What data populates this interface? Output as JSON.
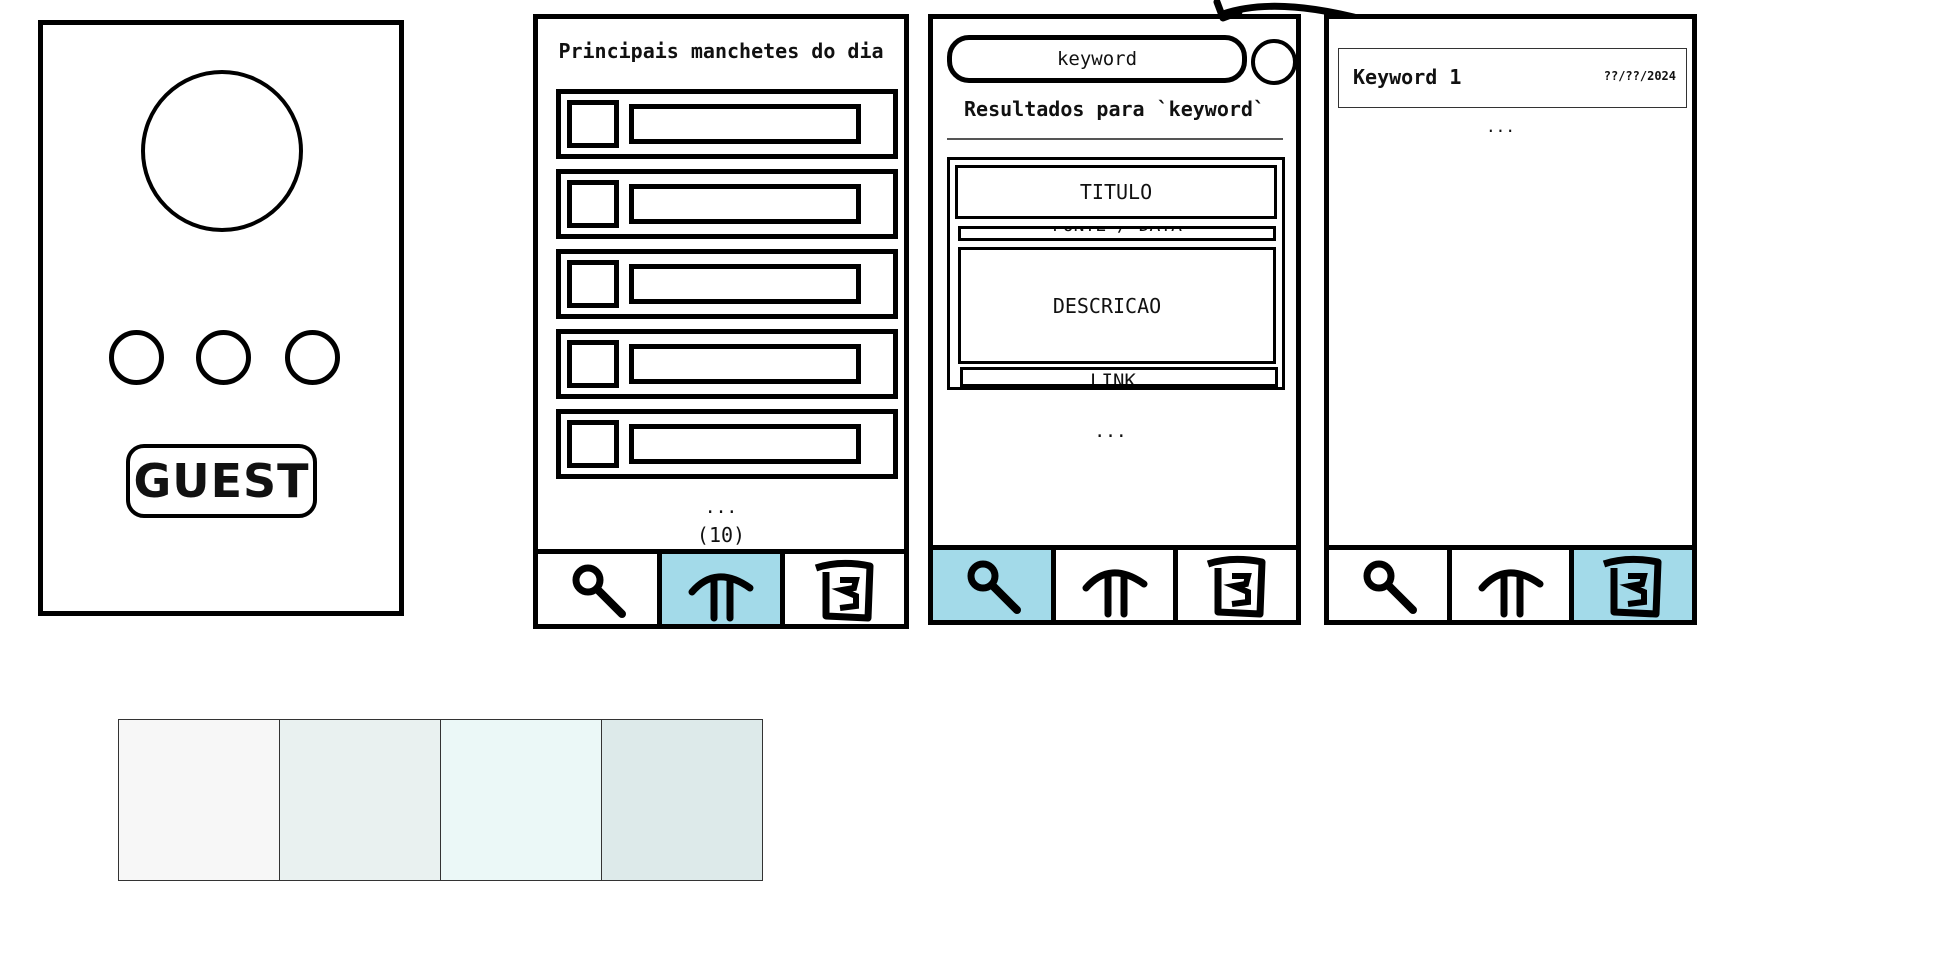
{
  "screen_login": {
    "guest_label": "GUEST"
  },
  "screen_home": {
    "title": "Principais manchetes do dia",
    "headline_count": 5,
    "ellipsis": "...",
    "count_label": "(10)",
    "active_tab": "home"
  },
  "screen_search": {
    "search_value": "keyword",
    "results_heading": "Resultados para `keyword`",
    "card": {
      "title": "TITULO",
      "source_date": "FONTE / DATA",
      "description": "DESCRICAO",
      "link": "LINK"
    },
    "ellipsis": "...",
    "active_tab": "search"
  },
  "screen_saved": {
    "items": [
      {
        "keyword": "Keyword 1",
        "date": "??/??/2024"
      }
    ],
    "ellipsis": "...",
    "active_tab": "saved"
  },
  "nav_icons": [
    "search-icon",
    "home-icon",
    "saved-document-icon"
  ],
  "palette": [
    "#f7f7f7",
    "#e9f1f0",
    "#ebf8f7",
    "#ddeaea"
  ],
  "accent_color": "#a3dae9"
}
